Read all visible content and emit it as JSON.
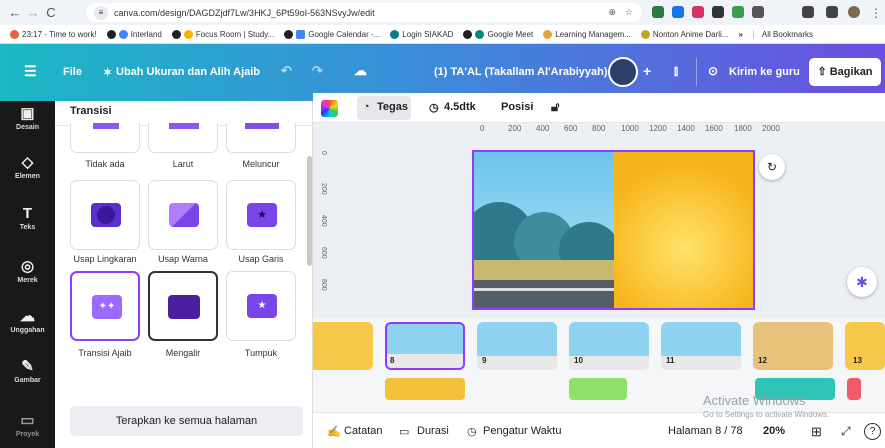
{
  "browser": {
    "url": "canva.com/design/DAGDZjdf7Lw/3HKJ_6Pt59oI-563NSvyJw/edit"
  },
  "bookmarks": [
    "23:17 - Time to work!",
    "Interland",
    "Focus Room | Study...",
    "Google Calendar -...",
    "Login SIAKAD",
    "Google Meet",
    "Learning Managem...",
    "Nonton Anime Darli...",
    "»",
    "All Bookmarks"
  ],
  "header": {
    "file": "File",
    "resize": "Ubah Ukuran dan Alih Ajaib",
    "doc_title": "(1) TA'AL (Takallam Al'Arabiyyah)",
    "send": "Kirim ke guru",
    "share": "Bagikan"
  },
  "rail": [
    "Desain",
    "Elemen",
    "Teks",
    "Merek",
    "Unggahan",
    "Gambar",
    "Proyek"
  ],
  "panel": {
    "title": "Transisi",
    "transitions": [
      "Tidak ada",
      "Larut",
      "Meluncur",
      "Usap Lingkaran",
      "Usap Warna",
      "Usap Garis",
      "Transisi Ajaib",
      "Mengalir",
      "Tumpuk"
    ],
    "apply_all": "Terapkan ke semua halaman"
  },
  "toolbar": {
    "style": "Tegas",
    "duration": "4.5dtk",
    "position": "Posisi"
  },
  "ruler": [
    "0",
    "200",
    "400",
    "600",
    "800",
    "1000",
    "1200",
    "1400",
    "1600",
    "1800",
    "2000"
  ],
  "vruler": [
    "0",
    "200",
    "400",
    "600",
    "800"
  ],
  "pages": [
    "8",
    "9",
    "10",
    "11",
    "12",
    "13"
  ],
  "footer": {
    "notes": "Catatan",
    "duration": "Durasi",
    "timer": "Pengatur Waktu",
    "page": "Halaman 8 / 78",
    "zoom": "20%"
  },
  "watermark": {
    "line1": "Activate Windows",
    "line2": "Go to Settings to activate Windows."
  }
}
